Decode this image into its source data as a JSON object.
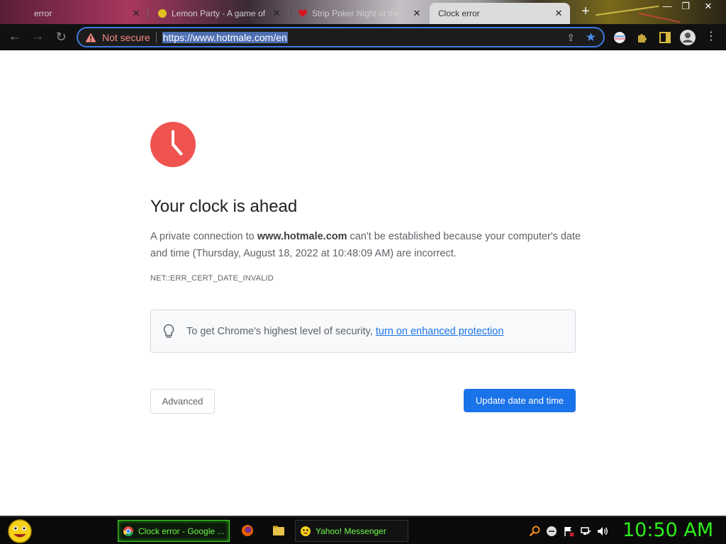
{
  "tabs": [
    {
      "title": "error",
      "active": false
    },
    {
      "title": "Lemon Party - A game of",
      "active": false
    },
    {
      "title": "Strip Poker Night at the",
      "active": false
    },
    {
      "title": "Clock error",
      "active": true
    }
  ],
  "new_tab_label": "+",
  "window_controls": {
    "minimize": "—",
    "maximize": "❐",
    "close": "✕"
  },
  "toolbar": {
    "security_label": "Not secure",
    "url": "https://www.hotmale.com/en"
  },
  "page": {
    "heading": "Your clock is ahead",
    "message_prefix": "A private connection to ",
    "message_domain": "www.hotmale.com",
    "message_suffix": " can't be established because your computer's date and time (Thursday, August 18, 2022 at 10:48:09 AM) are incorrect.",
    "error_code": "NET::ERR_CERT_DATE_INVALID",
    "tip_text": "To get Chrome's highest level of security,",
    "tip_link": "turn on enhanced protection",
    "advanced_label": "Advanced",
    "update_label": "Update date and time"
  },
  "taskbar": {
    "chrome_task": "Clock error - Google ...",
    "yahoo_task": "Yahoo! Messenger",
    "clock": "10:50 AM"
  },
  "colors": {
    "primary_blue": "#1a73e8",
    "clock_red": "#ef5350",
    "not_secure_red": "#f28b82",
    "taskbar_green": "#2ef01a"
  }
}
